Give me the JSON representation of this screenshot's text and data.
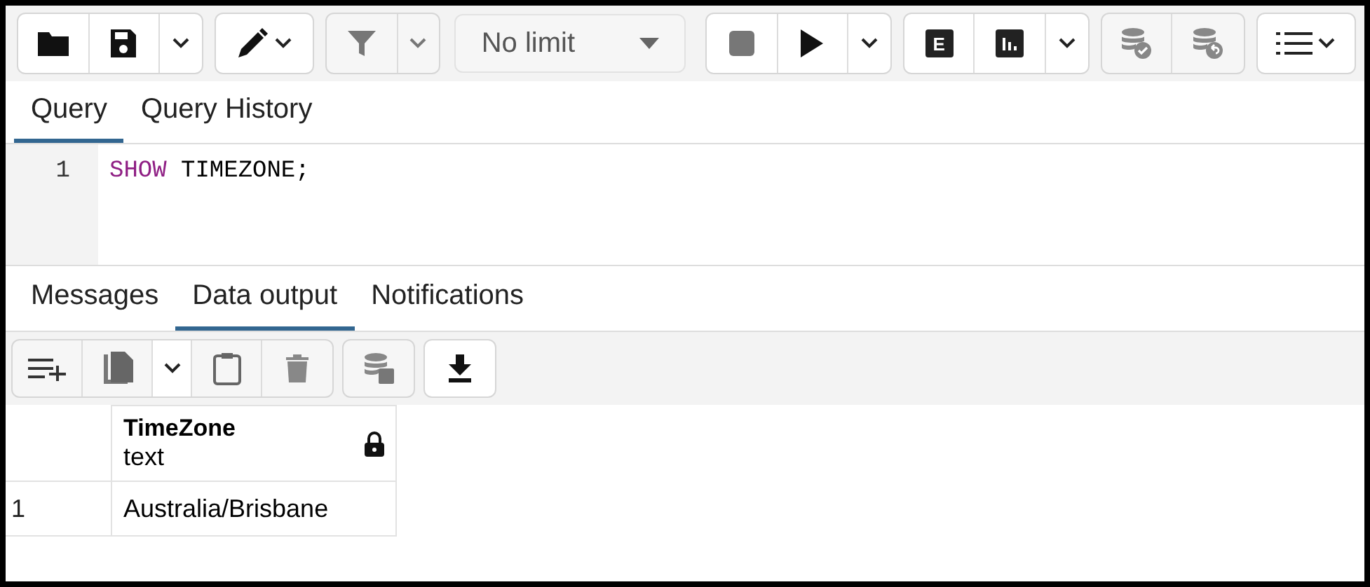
{
  "toolbar": {
    "limit_select": {
      "value": "No limit"
    },
    "explain_label": "E"
  },
  "editor_tabs": [
    {
      "label": "Query",
      "selected": true
    },
    {
      "label": "Query History",
      "selected": false
    }
  ],
  "editor": {
    "lines": [
      {
        "number": "1",
        "tokens": [
          {
            "kind": "keyword",
            "text": "SHOW"
          },
          {
            "kind": "plain",
            "text": " TIMEZONE;"
          }
        ]
      }
    ]
  },
  "result_tabs": [
    {
      "label": "Messages",
      "selected": false
    },
    {
      "label": "Data output",
      "selected": true
    },
    {
      "label": "Notifications",
      "selected": false
    }
  ],
  "table": {
    "columns": [
      {
        "name": "TimeZone",
        "type": "text",
        "locked": true
      }
    ],
    "rows": [
      {
        "number": "1",
        "cells": [
          "Australia/Brisbane"
        ]
      }
    ]
  }
}
